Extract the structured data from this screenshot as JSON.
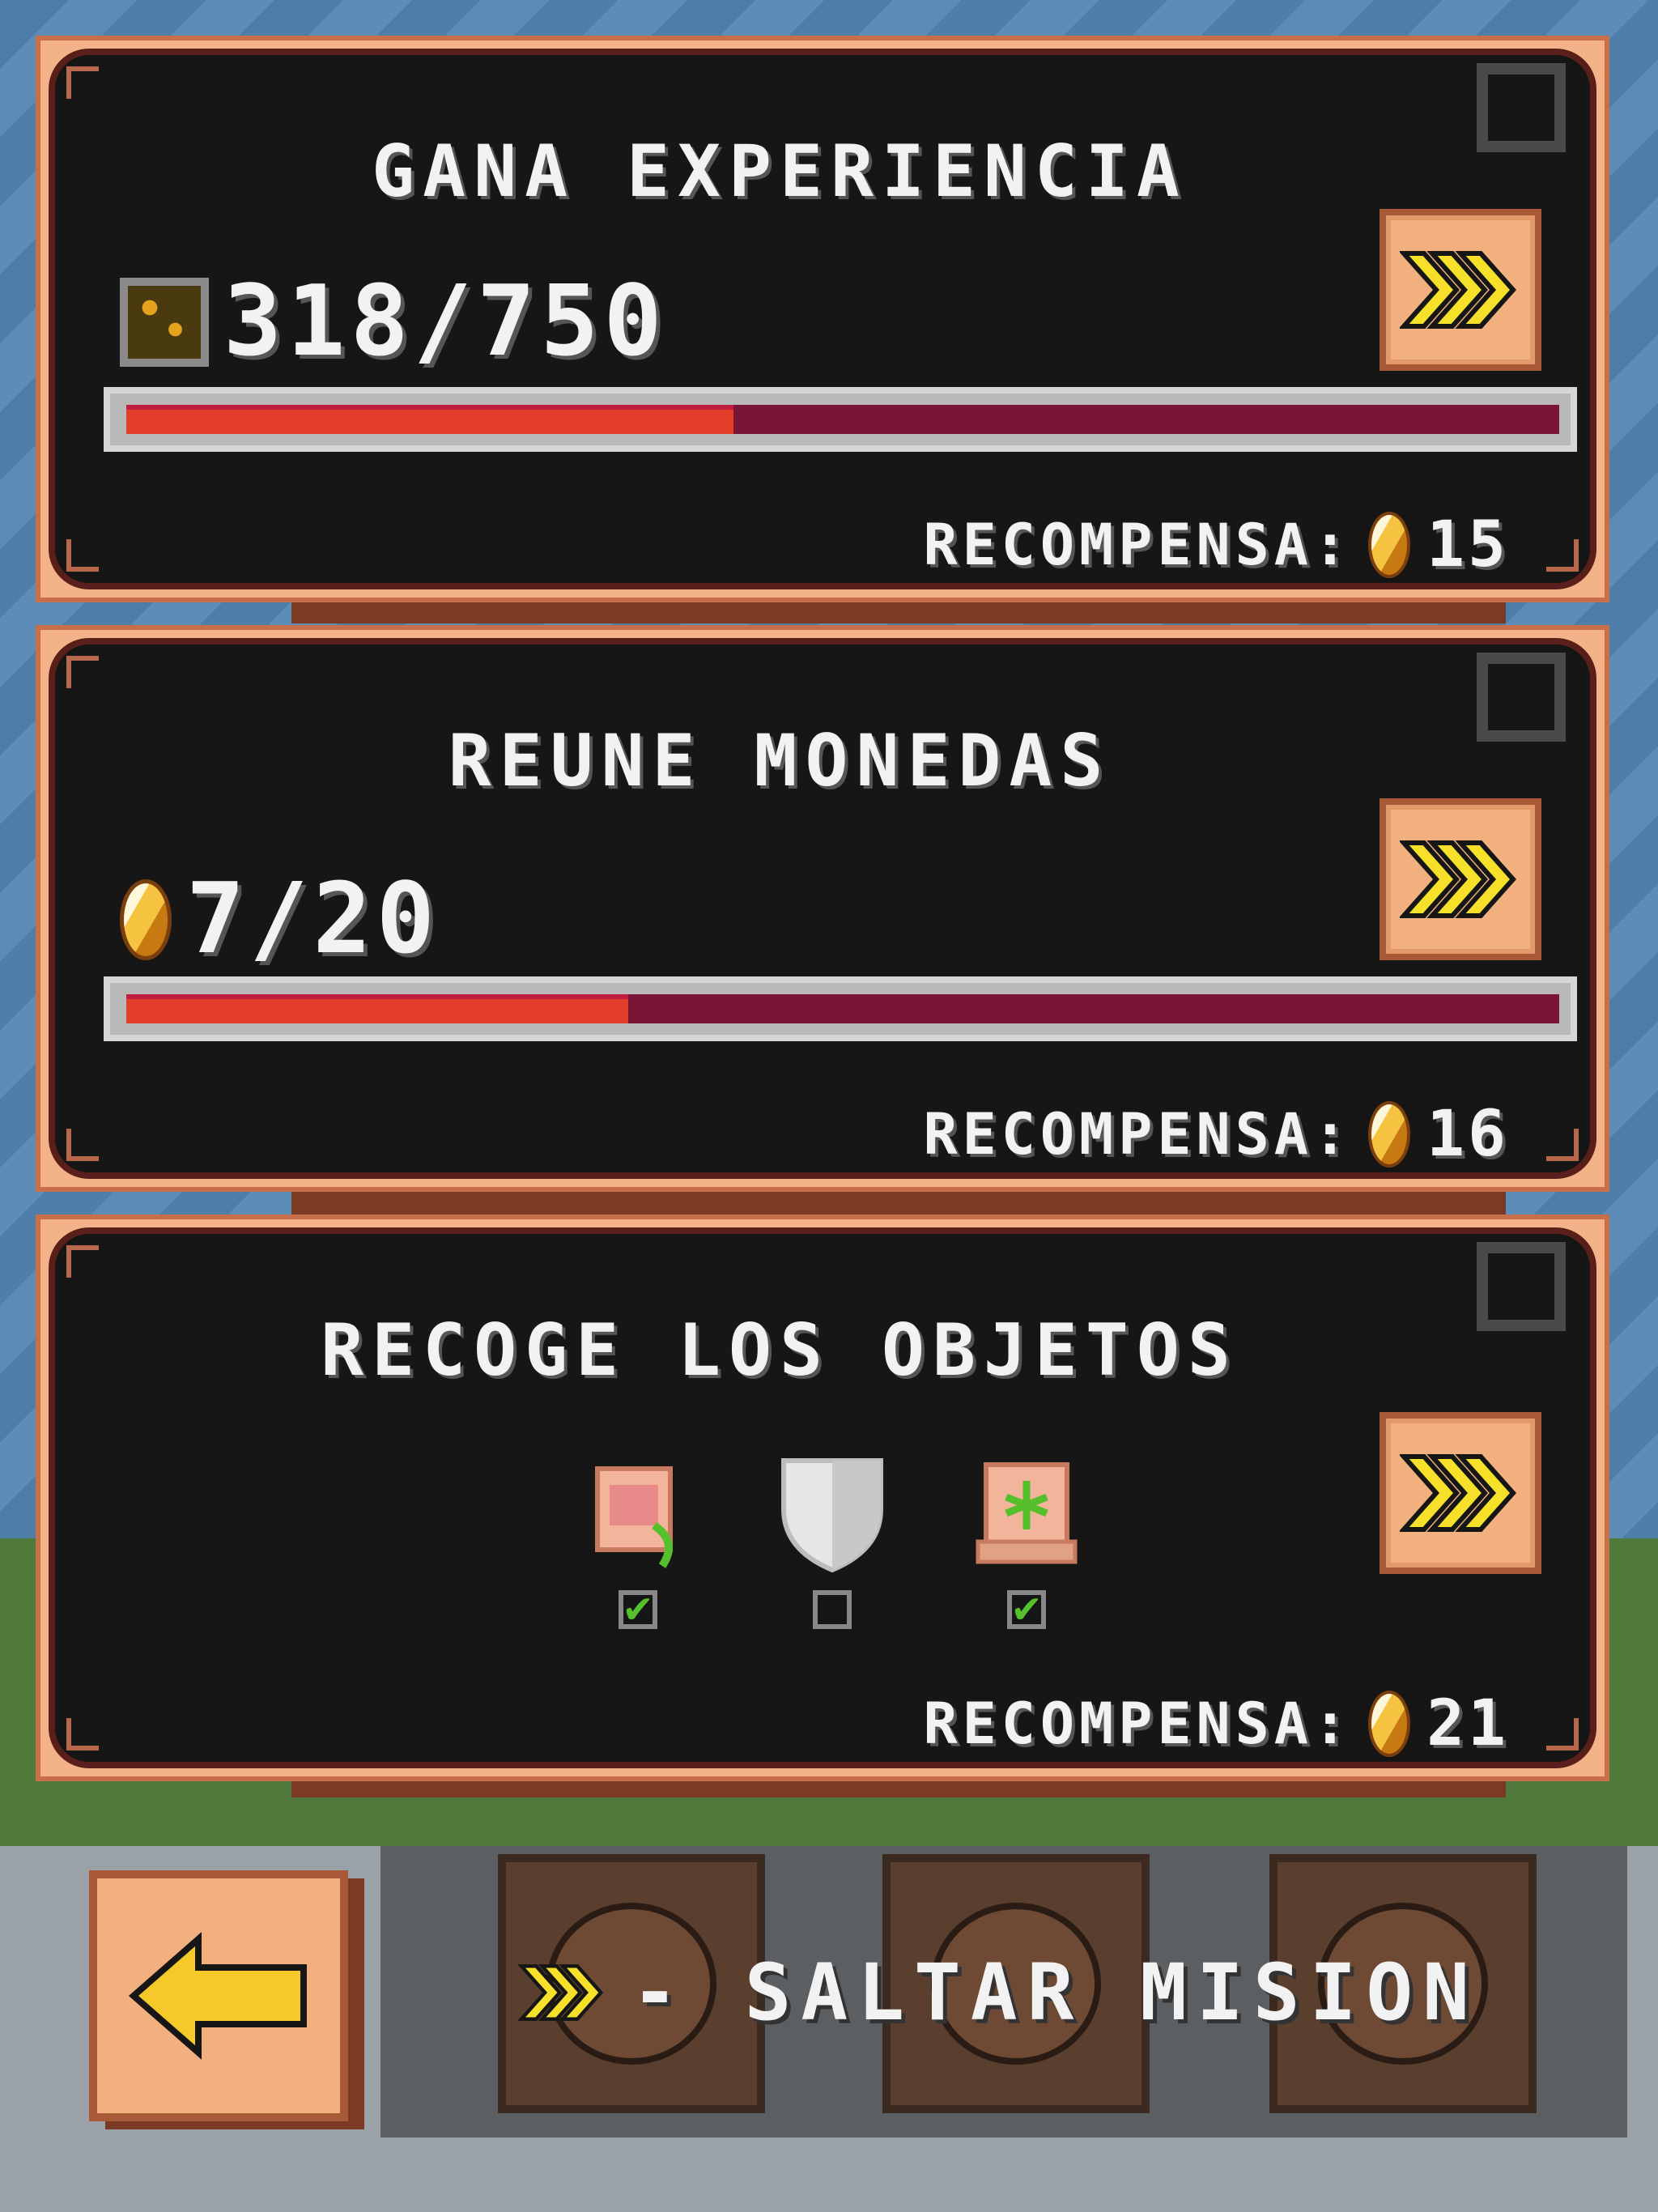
{
  "quests": [
    {
      "title": "GANA EXPERIENCIA",
      "progress_text": "318/750",
      "progress": 0.424,
      "progress_icon": "xp-icon",
      "reward_label": "RECOMPENSA:",
      "reward_value": "15",
      "completed": false
    },
    {
      "title": "REUNE MONEDAS",
      "progress_text": "7/20",
      "progress": 0.35,
      "progress_icon": "coin-icon",
      "reward_label": "RECOMPENSA:",
      "reward_value": "16",
      "completed": false
    },
    {
      "title": "RECOGE LOS OBJETOS",
      "items": [
        {
          "icon": "scroll-flower-icon",
          "collected": true
        },
        {
          "icon": "shield-icon",
          "collected": false
        },
        {
          "icon": "map-scroll-icon",
          "collected": true
        }
      ],
      "reward_label": "RECOMPENSA:",
      "reward_value": "21",
      "completed": false
    }
  ],
  "footer": {
    "skip_hint": "- SALTAR MISION",
    "back_icon": "arrow-left-icon",
    "skip_icon": "fast-forward-icon"
  },
  "colors": {
    "panel_border": "#f3b287",
    "panel_bg": "#161616",
    "bar_fill": "#e23e2a",
    "bar_empty": "#7b1536",
    "button_yellow": "#f6e02a"
  }
}
